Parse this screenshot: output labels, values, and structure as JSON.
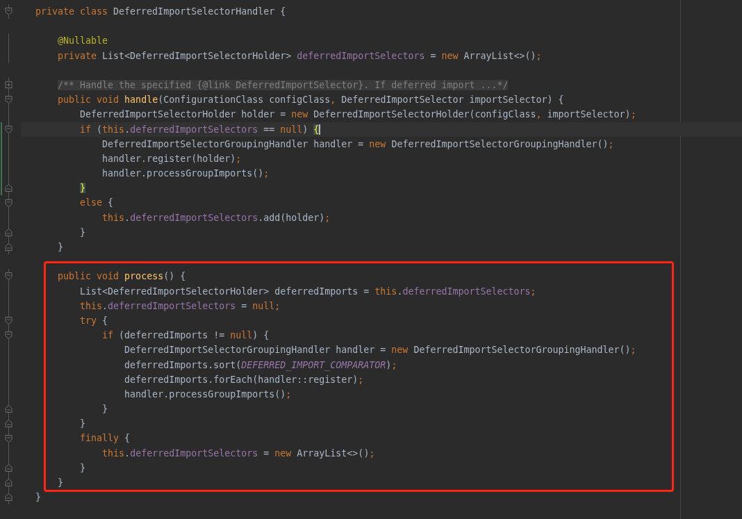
{
  "editor": {
    "lines": [
      {
        "gutter_icon": {
          "kind": "fold-start"
        },
        "tokens": [
          {
            "text": "private class ",
            "kind": "keyword"
          },
          {
            "text": "DeferredImportSelectorHandler {",
            "kind": "plain"
          }
        ]
      },
      {
        "blank_line_before": true,
        "tokens": [
          {
            "text": "    @Nullable",
            "kind": "annotation"
          }
        ]
      },
      {
        "tokens": [
          {
            "text": "    private ",
            "kind": "keyword"
          },
          {
            "text": "List<DeferredImportSelectorHolder> ",
            "kind": "plain"
          },
          {
            "text": "deferredImportSelectors",
            "kind": "field"
          },
          {
            "text": " = ",
            "kind": "plain"
          },
          {
            "text": "new ",
            "kind": "keyword"
          },
          {
            "text": "ArrayList<>()",
            "kind": "plain"
          },
          {
            "text": ";",
            "kind": "punct"
          }
        ]
      },
      {
        "blank_line_before": true,
        "gutter_icon": {
          "kind": "fold-collapsed"
        },
        "tokens": [
          {
            "text": "    /** Handle the specified {@link DeferredImportSelector}. If deferred import ...*/",
            "kind": "folded-comment"
          }
        ]
      },
      {
        "gutter_icon": {
          "kind": "fold-start"
        },
        "tokens": [
          {
            "text": "    public void ",
            "kind": "keyword"
          },
          {
            "text": "handle",
            "kind": "method"
          },
          {
            "text": "(ConfigurationClass configClass",
            "kind": "plain"
          },
          {
            "text": ", ",
            "kind": "punct"
          },
          {
            "text": "DeferredImportSelector importSelector) {",
            "kind": "plain"
          }
        ]
      },
      {
        "tokens": [
          {
            "text": "        DeferredImportSelectorHolder holder = ",
            "kind": "plain"
          },
          {
            "text": "new ",
            "kind": "keyword"
          },
          {
            "text": "DeferredImportSelectorHolder(configClass",
            "kind": "plain"
          },
          {
            "text": ", ",
            "kind": "punct"
          },
          {
            "text": "importSelector)",
            "kind": "plain"
          },
          {
            "text": ";",
            "kind": "punct"
          }
        ]
      },
      {
        "gutter_icon": {
          "kind": "fold-start"
        },
        "current": true,
        "changed": true,
        "tokens": [
          {
            "text": "        if ",
            "kind": "keyword"
          },
          {
            "text": "(",
            "kind": "plain"
          },
          {
            "text": "this",
            "kind": "keyword"
          },
          {
            "text": ".",
            "kind": "plain"
          },
          {
            "text": "deferredImportSelectors",
            "kind": "field"
          },
          {
            "text": " == ",
            "kind": "plain"
          },
          {
            "text": "null",
            "kind": "keyword"
          },
          {
            "text": ") ",
            "kind": "plain"
          },
          {
            "text": "{",
            "kind": "matched-brace",
            "caret": true
          }
        ]
      },
      {
        "changed": true,
        "tokens": [
          {
            "text": "            DeferredImportSelectorGroupingHandler handler = ",
            "kind": "plain"
          },
          {
            "text": "new ",
            "kind": "keyword"
          },
          {
            "text": "DeferredImportSelectorGroupingHandler()",
            "kind": "plain"
          },
          {
            "text": ";",
            "kind": "punct"
          }
        ]
      },
      {
        "changed": true,
        "tokens": [
          {
            "text": "            handler.register(holder)",
            "kind": "plain"
          },
          {
            "text": ";",
            "kind": "punct"
          }
        ]
      },
      {
        "changed": true,
        "tokens": [
          {
            "text": "            handler.processGroupImports()",
            "kind": "plain"
          },
          {
            "text": ";",
            "kind": "punct"
          }
        ]
      },
      {
        "gutter_icon": {
          "kind": "fold-end"
        },
        "changed": true,
        "tokens": [
          {
            "text": "        }",
            "kind": "matched-brace"
          }
        ]
      },
      {
        "gutter_icon": {
          "kind": "fold-start"
        },
        "tokens": [
          {
            "text": "        else ",
            "kind": "keyword"
          },
          {
            "text": "{",
            "kind": "plain"
          }
        ]
      },
      {
        "tokens": [
          {
            "text": "            this",
            "kind": "keyword"
          },
          {
            "text": ".",
            "kind": "plain"
          },
          {
            "text": "deferredImportSelectors",
            "kind": "field"
          },
          {
            "text": ".add(holder)",
            "kind": "plain"
          },
          {
            "text": ";",
            "kind": "punct"
          }
        ]
      },
      {
        "gutter_icon": {
          "kind": "fold-end"
        },
        "tokens": [
          {
            "text": "        }",
            "kind": "plain"
          }
        ]
      },
      {
        "gutter_icon": {
          "kind": "fold-end"
        },
        "tokens": [
          {
            "text": "    }",
            "kind": "plain"
          }
        ]
      },
      {
        "blank_line_before": true,
        "gutter_icon": {
          "kind": "fold-start"
        },
        "boxed": true,
        "tokens": [
          {
            "text": "    public void ",
            "kind": "keyword"
          },
          {
            "text": "process",
            "kind": "method"
          },
          {
            "text": "() {",
            "kind": "plain"
          }
        ]
      },
      {
        "boxed": true,
        "tokens": [
          {
            "text": "        List<DeferredImportSelectorHolder> deferredImports = ",
            "kind": "plain"
          },
          {
            "text": "this",
            "kind": "keyword"
          },
          {
            "text": ".",
            "kind": "plain"
          },
          {
            "text": "deferredImportSelectors",
            "kind": "field"
          },
          {
            "text": ";",
            "kind": "punct"
          }
        ]
      },
      {
        "boxed": true,
        "tokens": [
          {
            "text": "        this",
            "kind": "keyword"
          },
          {
            "text": ".",
            "kind": "plain"
          },
          {
            "text": "deferredImportSelectors",
            "kind": "field"
          },
          {
            "text": " = ",
            "kind": "plain"
          },
          {
            "text": "null",
            "kind": "keyword"
          },
          {
            "text": ";",
            "kind": "punct"
          }
        ]
      },
      {
        "gutter_icon": {
          "kind": "fold-start"
        },
        "boxed": true,
        "tokens": [
          {
            "text": "        try ",
            "kind": "keyword"
          },
          {
            "text": "{",
            "kind": "plain"
          }
        ]
      },
      {
        "gutter_icon": {
          "kind": "fold-start"
        },
        "boxed": true,
        "tokens": [
          {
            "text": "            if ",
            "kind": "keyword"
          },
          {
            "text": "(deferredImports != ",
            "kind": "plain"
          },
          {
            "text": "null",
            "kind": "keyword"
          },
          {
            "text": ") {",
            "kind": "plain"
          }
        ]
      },
      {
        "boxed": true,
        "tokens": [
          {
            "text": "                DeferredImportSelectorGroupingHandler handler = ",
            "kind": "plain"
          },
          {
            "text": "new ",
            "kind": "keyword"
          },
          {
            "text": "DeferredImportSelectorGroupingHandler()",
            "kind": "plain"
          },
          {
            "text": ";",
            "kind": "punct"
          }
        ]
      },
      {
        "boxed": true,
        "tokens": [
          {
            "text": "                deferredImports.sort(",
            "kind": "plain"
          },
          {
            "text": "DEFERRED_IMPORT_COMPARATOR",
            "kind": "static-field"
          },
          {
            "text": ")",
            "kind": "plain"
          },
          {
            "text": ";",
            "kind": "punct"
          }
        ]
      },
      {
        "boxed": true,
        "tokens": [
          {
            "text": "                deferredImports.forEach(handler::register)",
            "kind": "plain"
          },
          {
            "text": ";",
            "kind": "punct"
          }
        ]
      },
      {
        "boxed": true,
        "tokens": [
          {
            "text": "                handler.processGroupImports()",
            "kind": "plain"
          },
          {
            "text": ";",
            "kind": "punct"
          }
        ]
      },
      {
        "gutter_icon": {
          "kind": "fold-end"
        },
        "boxed": true,
        "tokens": [
          {
            "text": "            }",
            "kind": "plain"
          }
        ]
      },
      {
        "gutter_icon": {
          "kind": "fold-end"
        },
        "boxed": true,
        "tokens": [
          {
            "text": "        }",
            "kind": "plain"
          }
        ]
      },
      {
        "gutter_icon": {
          "kind": "fold-start"
        },
        "boxed": true,
        "tokens": [
          {
            "text": "        finally ",
            "kind": "keyword"
          },
          {
            "text": "{",
            "kind": "plain"
          }
        ]
      },
      {
        "boxed": true,
        "tokens": [
          {
            "text": "            this",
            "kind": "keyword"
          },
          {
            "text": ".",
            "kind": "plain"
          },
          {
            "text": "deferredImportSelectors",
            "kind": "field"
          },
          {
            "text": " = ",
            "kind": "plain"
          },
          {
            "text": "new ",
            "kind": "keyword"
          },
          {
            "text": "ArrayList<>()",
            "kind": "plain"
          },
          {
            "text": ";",
            "kind": "punct"
          }
        ]
      },
      {
        "gutter_icon": {
          "kind": "fold-end"
        },
        "boxed": true,
        "tokens": [
          {
            "text": "        }",
            "kind": "plain"
          }
        ]
      },
      {
        "gutter_icon": {
          "kind": "fold-end"
        },
        "boxed": true,
        "tokens": [
          {
            "text": "    }",
            "kind": "plain"
          }
        ]
      },
      {
        "gutter_icon": {
          "kind": "fold-end"
        },
        "tokens": [
          {
            "text": "}",
            "kind": "plain"
          }
        ]
      }
    ]
  }
}
